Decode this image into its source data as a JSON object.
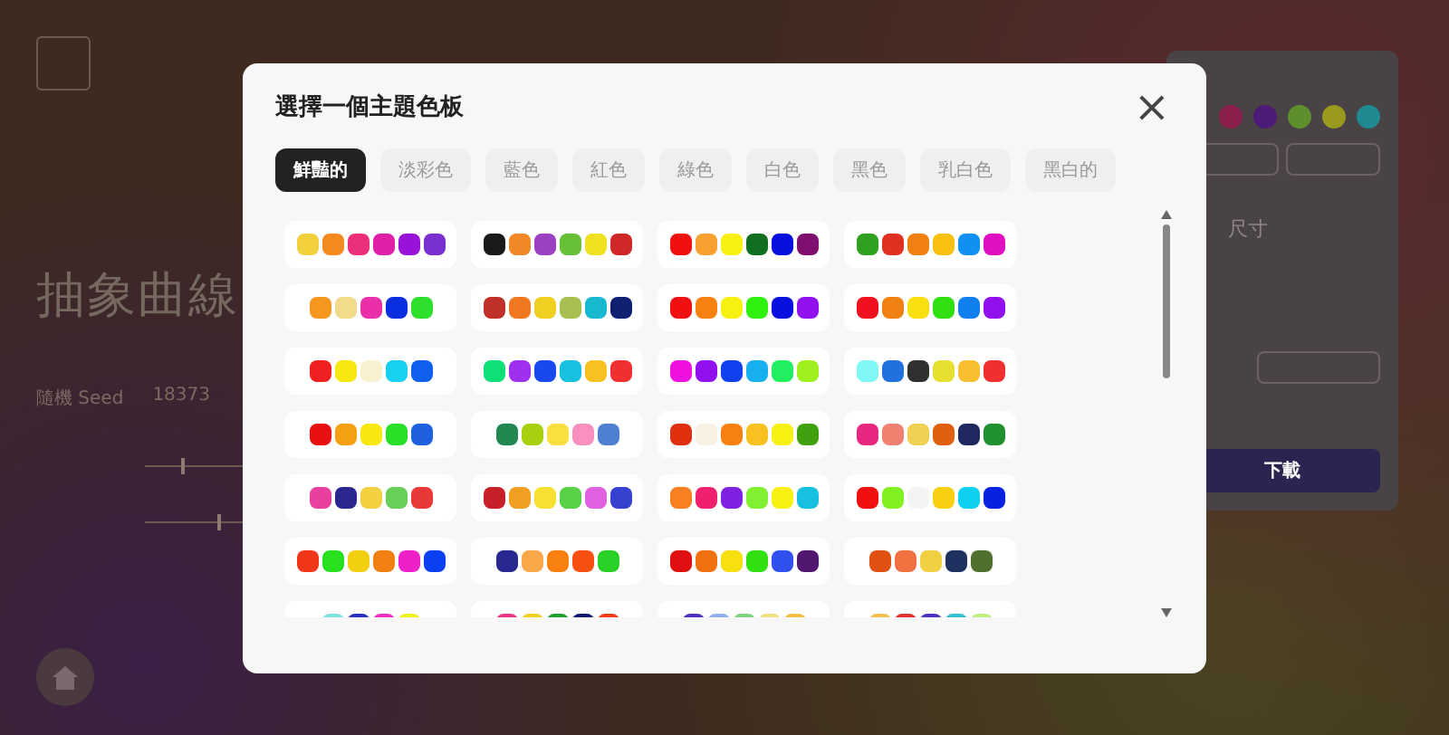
{
  "background": {
    "title": "抽象曲線",
    "seed_label": "隨機 Seed",
    "seed_value": "18373",
    "sliders": [
      {
        "level": 0.2
      },
      {
        "level": 0.4
      }
    ],
    "panel": {
      "colors": [
        {
          "color": "#8a1f4c"
        },
        {
          "color": "#4e1a78"
        },
        {
          "color": "#5f8f2c"
        },
        {
          "color": "#9a9a1e"
        },
        {
          "color": "#1f8a92"
        }
      ],
      "size_label": "尺寸",
      "download": "下載"
    }
  },
  "modal": {
    "title": "選擇一個主題色板",
    "close": "×",
    "tabs": [
      {
        "label": "鮮豔的",
        "selected": true
      },
      {
        "label": "淡彩色",
        "selected": false
      },
      {
        "label": "藍色",
        "selected": false
      },
      {
        "label": "紅色",
        "selected": false
      },
      {
        "label": "綠色",
        "selected": false
      },
      {
        "label": "白色",
        "selected": false
      },
      {
        "label": "黑色",
        "selected": false
      },
      {
        "label": "乳白色",
        "selected": false
      },
      {
        "label": "黑白的",
        "selected": false
      }
    ],
    "palettes": [
      {
        "colors": [
          {
            "color": "#f2d03b"
          },
          {
            "color": "#f58a1f"
          },
          {
            "color": "#ec2f7a"
          },
          {
            "color": "#e020a8"
          },
          {
            "color": "#9a12d8"
          },
          {
            "color": "#7a2fd0"
          }
        ]
      },
      {
        "colors": [
          {
            "color": "#1a1a1a"
          },
          {
            "color": "#f08828"
          },
          {
            "color": "#9a40c0"
          },
          {
            "color": "#68c038"
          },
          {
            "color": "#f0e020"
          },
          {
            "color": "#d02828"
          }
        ]
      },
      {
        "colors": [
          {
            "color": "#f01010"
          },
          {
            "color": "#f8a030"
          },
          {
            "color": "#f8f010"
          },
          {
            "color": "#107020"
          },
          {
            "color": "#0810e0"
          },
          {
            "color": "#801070"
          }
        ]
      },
      {
        "colors": [
          {
            "color": "#30a020"
          },
          {
            "color": "#e03020"
          },
          {
            "color": "#f08010"
          },
          {
            "color": "#f8c010"
          },
          {
            "color": "#1090f0"
          },
          {
            "color": "#e010c0"
          }
        ]
      },
      {
        "colors": [
          {
            "color": "#f5961e"
          },
          {
            "color": "#f2dc8c"
          },
          {
            "color": "#ea2fa8"
          },
          {
            "color": "#0a2fe0"
          },
          {
            "color": "#2ee02e"
          }
        ]
      },
      {
        "colors": [
          {
            "color": "#c03028"
          },
          {
            "color": "#f07820"
          },
          {
            "color": "#f0d020"
          },
          {
            "color": "#a8c050"
          },
          {
            "color": "#18b8d0"
          },
          {
            "color": "#102070"
          }
        ]
      },
      {
        "colors": [
          {
            "color": "#f01010"
          },
          {
            "color": "#f88010"
          },
          {
            "color": "#f8f010"
          },
          {
            "color": "#30f010"
          },
          {
            "color": "#0810e0"
          },
          {
            "color": "#9010f0"
          }
        ]
      },
      {
        "colors": [
          {
            "color": "#f01020"
          },
          {
            "color": "#f08010"
          },
          {
            "color": "#f8e010"
          },
          {
            "color": "#30e010"
          },
          {
            "color": "#1080f0"
          },
          {
            "color": "#9010f0"
          }
        ]
      },
      {
        "colors": [
          {
            "color": "#f02020"
          },
          {
            "color": "#f8e812"
          },
          {
            "color": "#f8f2d0"
          },
          {
            "color": "#18d0f0"
          },
          {
            "color": "#1060f0"
          }
        ]
      },
      {
        "colors": [
          {
            "color": "#10e078"
          },
          {
            "color": "#a030f0"
          },
          {
            "color": "#1848f0"
          },
          {
            "color": "#18c0e0"
          },
          {
            "color": "#f8c020"
          },
          {
            "color": "#f03030"
          }
        ]
      },
      {
        "colors": [
          {
            "color": "#f010e0"
          },
          {
            "color": "#9010f0"
          },
          {
            "color": "#1040f0"
          },
          {
            "color": "#18b0f0"
          },
          {
            "color": "#20f060"
          },
          {
            "color": "#a0f020"
          }
        ]
      },
      {
        "colors": [
          {
            "color": "#80f8f8"
          },
          {
            "color": "#2070e0"
          },
          {
            "color": "#303030"
          },
          {
            "color": "#e8e030"
          },
          {
            "color": "#f8c030"
          },
          {
            "color": "#f03030"
          }
        ]
      },
      {
        "colors": [
          {
            "color": "#e81010"
          },
          {
            "color": "#f5a010"
          },
          {
            "color": "#f8e810"
          },
          {
            "color": "#28e028"
          },
          {
            "color": "#1e60e0"
          }
        ]
      },
      {
        "colors": [
          {
            "color": "#208850"
          },
          {
            "color": "#a8d010"
          },
          {
            "color": "#f8e040"
          },
          {
            "color": "#f890c0"
          },
          {
            "color": "#5080d0"
          }
        ]
      },
      {
        "colors": [
          {
            "color": "#e03010"
          },
          {
            "color": "#f8f0e0"
          },
          {
            "color": "#f88010"
          },
          {
            "color": "#f8c020"
          },
          {
            "color": "#f8f010"
          },
          {
            "color": "#40a010"
          }
        ]
      },
      {
        "colors": [
          {
            "color": "#e82880"
          },
          {
            "color": "#f08070"
          },
          {
            "color": "#f0d050"
          },
          {
            "color": "#e06010"
          },
          {
            "color": "#202860"
          },
          {
            "color": "#209030"
          }
        ]
      },
      {
        "colors": [
          {
            "color": "#e840a0"
          },
          {
            "color": "#2a2890"
          },
          {
            "color": "#f2d040"
          },
          {
            "color": "#68d058"
          },
          {
            "color": "#e83838"
          }
        ]
      },
      {
        "colors": [
          {
            "color": "#c82028"
          },
          {
            "color": "#f0a020"
          },
          {
            "color": "#f8e030"
          },
          {
            "color": "#58d048"
          },
          {
            "color": "#e060e0"
          },
          {
            "color": "#3840d0"
          }
        ]
      },
      {
        "colors": [
          {
            "color": "#f88020"
          },
          {
            "color": "#f02070"
          },
          {
            "color": "#8020e0"
          },
          {
            "color": "#80f030"
          },
          {
            "color": "#f8f010"
          },
          {
            "color": "#18c0e0"
          }
        ]
      },
      {
        "colors": [
          {
            "color": "#f01010"
          },
          {
            "color": "#80f020"
          },
          {
            "color": "#f4f4f4"
          },
          {
            "color": "#f8d010"
          },
          {
            "color": "#10d0f0"
          },
          {
            "color": "#0820e0"
          }
        ]
      },
      {
        "colors": [
          {
            "color": "#f03818"
          },
          {
            "color": "#28e020"
          },
          {
            "color": "#f0d010"
          },
          {
            "color": "#f08010"
          },
          {
            "color": "#f020c8"
          },
          {
            "color": "#0a40f0"
          }
        ]
      },
      {
        "colors": [
          {
            "color": "#282890"
          },
          {
            "color": "#f8a848"
          },
          {
            "color": "#f88010"
          },
          {
            "color": "#f85010"
          },
          {
            "color": "#28d028"
          }
        ]
      },
      {
        "colors": [
          {
            "color": "#e01010"
          },
          {
            "color": "#f07010"
          },
          {
            "color": "#f8e010"
          },
          {
            "color": "#30e010"
          },
          {
            "color": "#3050f0"
          },
          {
            "color": "#501870"
          }
        ]
      },
      {
        "colors": [
          {
            "color": "#e05010"
          },
          {
            "color": "#f07040"
          },
          {
            "color": "#f0d040"
          },
          {
            "color": "#203060"
          },
          {
            "color": "#507030"
          }
        ]
      },
      {
        "colors": [
          {
            "color": "#80e0e0"
          },
          {
            "color": "#2830c0"
          },
          {
            "color": "#f030c0"
          },
          {
            "color": "#f0f020"
          }
        ]
      },
      {
        "colors": [
          {
            "color": "#e83888"
          },
          {
            "color": "#f0d020"
          },
          {
            "color": "#20a030"
          },
          {
            "color": "#101870"
          },
          {
            "color": "#f04020"
          }
        ]
      },
      {
        "colors": [
          {
            "color": "#5030c0"
          },
          {
            "color": "#90b0f0"
          },
          {
            "color": "#80d080"
          },
          {
            "color": "#f0e080"
          },
          {
            "color": "#f0c040"
          }
        ]
      },
      {
        "colors": [
          {
            "color": "#f0c050"
          },
          {
            "color": "#e03030"
          },
          {
            "color": "#5030c0"
          },
          {
            "color": "#30c0d0"
          },
          {
            "color": "#c0f080"
          }
        ]
      }
    ]
  }
}
